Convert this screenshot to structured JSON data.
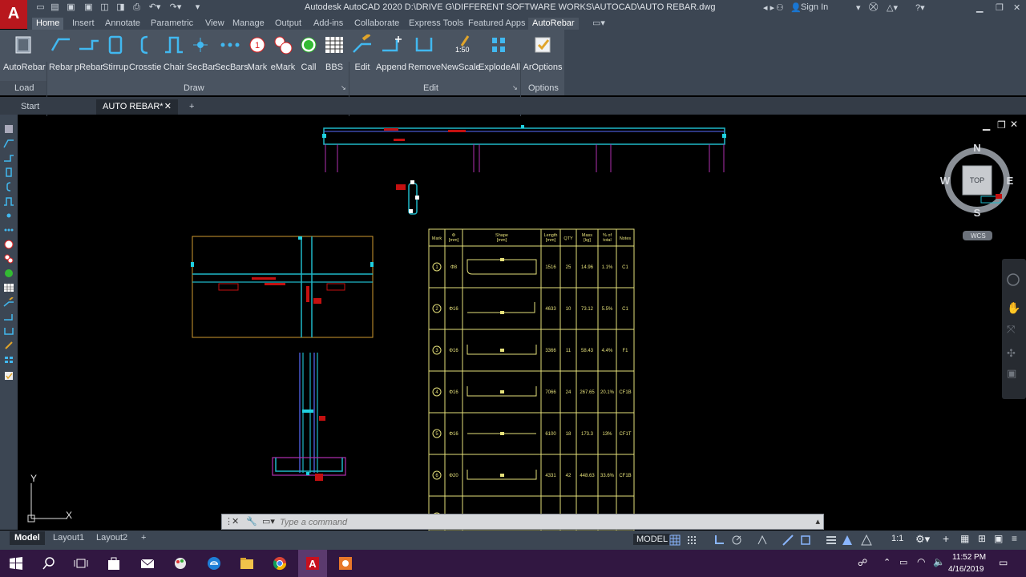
{
  "window": {
    "title": "Autodesk AutoCAD 2020    D:\\DRIVE G\\DIFFERENT SOFTWARE WORKS\\AUTOCAD\\AUTO REBAR.dwg",
    "sign_in": "Sign In",
    "app_letter": "A"
  },
  "ribbon_tabs": [
    "Home",
    "Insert",
    "Annotate",
    "Parametric",
    "View",
    "Manage",
    "Output",
    "Add-ins",
    "Collaborate",
    "Express Tools",
    "Featured Apps",
    "AutoRebar"
  ],
  "active_tab": "Home",
  "ribbon": {
    "load": {
      "title": "Load",
      "buttons": [
        "AutoRebar"
      ]
    },
    "draw": {
      "title": "Draw",
      "buttons": [
        "Rebar",
        "pRebar",
        "Stirrup",
        "Crosstie",
        "Chair",
        "SecBar",
        "SecBars",
        "Mark",
        "eMark",
        "Call",
        "BBS"
      ]
    },
    "edit": {
      "title": "Edit",
      "buttons": [
        "Edit",
        "Append",
        "Remove",
        "NewScale",
        "ExplodeAll"
      ]
    },
    "options": {
      "title": "Options",
      "buttons": [
        "ArOptions"
      ]
    },
    "mark_number": "1",
    "newscale_text": "1:50"
  },
  "file_tabs": {
    "start": "Start",
    "doc": "AUTO REBAR*"
  },
  "viewcube": {
    "n": "N",
    "s": "S",
    "e": "E",
    "w": "W",
    "face": "TOP",
    "wcs": "WCS"
  },
  "ucs": {
    "x": "X",
    "y": "Y"
  },
  "schedule": {
    "headers": [
      "Mark",
      "Φ\n[mm]",
      "Shape\n[mm]",
      "Length\n[mm]",
      "QTY",
      "Mass\n[kg]",
      "% of\ntotal",
      "Notes"
    ],
    "rows": [
      {
        "mark": "1",
        "dia": "Φ8",
        "length": "1516",
        "qty": "25",
        "mass": "14.96",
        "pct": "1.1%",
        "notes": "C1"
      },
      {
        "mark": "2",
        "dia": "Φ16",
        "length": "4633",
        "qty": "10",
        "mass": "73.12",
        "pct": "5.5%",
        "notes": "C1"
      },
      {
        "mark": "3",
        "dia": "Φ16",
        "length": "3366",
        "qty": "11",
        "mass": "58.43",
        "pct": "4.4%",
        "notes": "F1"
      },
      {
        "mark": "4",
        "dia": "Φ16",
        "length": "7066",
        "qty": "24",
        "mass": "267.65",
        "pct": "20.1%",
        "notes": "CF1B"
      },
      {
        "mark": "5",
        "dia": "Φ16",
        "length": "6100",
        "qty": "18",
        "mass": "173.3",
        "pct": "13%",
        "notes": "CF1T"
      },
      {
        "mark": "6",
        "dia": "Φ20",
        "length": "4331",
        "qty": "42",
        "mass": "448.63",
        "pct": "33.6%",
        "notes": "CF1B"
      },
      {
        "mark": "7",
        "dia": "Φ16",
        "length": "3400",
        "qty": "32",
        "mass": "171.72",
        "pct": "12.9%",
        "notes": "CF1T"
      }
    ]
  },
  "command": {
    "placeholder": "Type a command"
  },
  "layout_tabs": [
    "Model",
    "Layout1",
    "Layout2"
  ],
  "status": {
    "model": "MODEL",
    "scale": "1:1"
  },
  "clock": {
    "time": "11:52 PM",
    "date": "4/16/2019"
  },
  "colors": {
    "accent_red": "#b8171d",
    "ribbon_bg": "#4a5461",
    "canvas": "#000000",
    "taskbar": "#311741",
    "rebar_cyan": "#22c7d6",
    "table_yellow": "#e5e07a"
  }
}
